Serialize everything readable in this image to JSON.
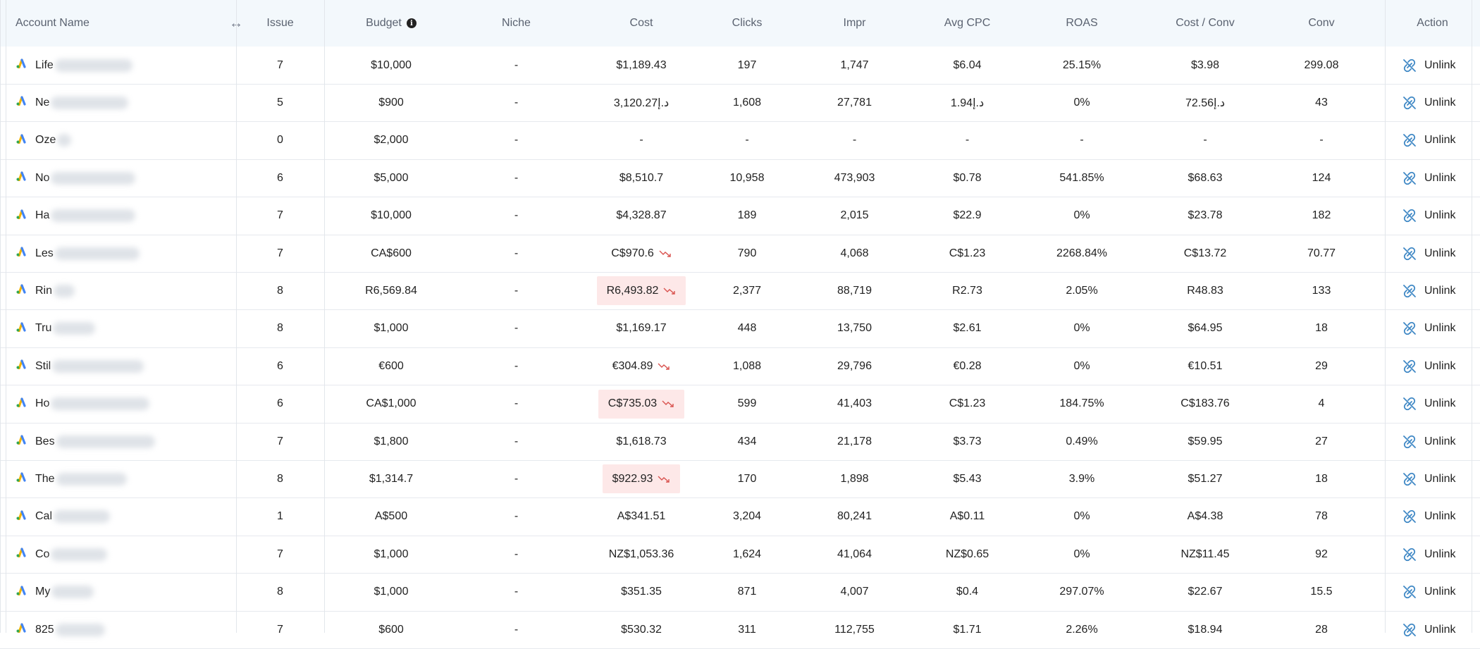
{
  "header": {
    "account_name": "Account Name",
    "issue": "Issue",
    "budget": "Budget",
    "niche": "Niche",
    "cost": "Cost",
    "clicks": "Clicks",
    "impr": "Impr",
    "avg_cpc": "Avg CPC",
    "roas": "ROAS",
    "cost_conv": "Cost / Conv",
    "conv": "Conv",
    "action": "Action"
  },
  "icons": {
    "column_resize": "left-right-arrow-icon",
    "budget_info": "info-icon",
    "account_platform": "google-ads-icon",
    "unlink": "unlink-icon",
    "trend_down": "trend-down-icon"
  },
  "colors": {
    "issue": "#cf6a66",
    "link": "#3f88c5",
    "cost_alert_bg": "#fde8e8",
    "header_bg": "#f3f8fc"
  },
  "rows": [
    {
      "name": "Life",
      "issue": "7",
      "budget": "$10,000",
      "niche": "-",
      "cost": "$1,189.43",
      "clicks": "197",
      "impr": "1,747",
      "avg_cpc": "$6.04",
      "roas": "25.15%",
      "cost_conv": "$3.98",
      "conv": "299.08",
      "action": "Unlink"
    },
    {
      "name": "Ne",
      "issue": "5",
      "budget": "$900",
      "niche": "-",
      "cost": "3,120.27د.إ",
      "clicks": "1,608",
      "impr": "27,781",
      "avg_cpc": "1.94د.إ",
      "roas": "0%",
      "cost_conv": "72.56د.إ",
      "conv": "43",
      "action": "Unlink"
    },
    {
      "name": "Oze",
      "issue": "0",
      "budget": "$2,000",
      "niche": "-",
      "cost": "-",
      "clicks": "-",
      "impr": "-",
      "avg_cpc": "-",
      "roas": "-",
      "cost_conv": "-",
      "conv": "-",
      "action": "Unlink"
    },
    {
      "name": "No",
      "issue": "6",
      "budget": "$5,000",
      "niche": "-",
      "cost": "$8,510.7",
      "clicks": "10,958",
      "impr": "473,903",
      "avg_cpc": "$0.78",
      "roas": "541.85%",
      "cost_conv": "$68.63",
      "conv": "124",
      "action": "Unlink"
    },
    {
      "name": "Ha",
      "issue": "7",
      "budget": "$10,000",
      "niche": "-",
      "cost": "$4,328.87",
      "clicks": "189",
      "impr": "2,015",
      "avg_cpc": "$22.9",
      "roas": "0%",
      "cost_conv": "$23.78",
      "conv": "182",
      "action": "Unlink"
    },
    {
      "name": "Les",
      "issue": "7",
      "budget": "CA$600",
      "niche": "-",
      "cost": "C$970.6",
      "cost_trend": true,
      "clicks": "790",
      "impr": "4,068",
      "avg_cpc": "C$1.23",
      "roas": "2268.84%",
      "cost_conv": "C$13.72",
      "conv": "70.77",
      "action": "Unlink"
    },
    {
      "name": "Rin",
      "issue": "8",
      "budget": "R6,569.84",
      "budget_link": true,
      "niche": "-",
      "cost": "R6,493.82",
      "cost_trend": true,
      "cost_alert": true,
      "clicks": "2,377",
      "impr": "88,719",
      "avg_cpc": "R2.73",
      "roas": "2.05%",
      "cost_conv": "R48.83",
      "conv": "133",
      "action": "Unlink"
    },
    {
      "name": "Tru",
      "issue": "8",
      "budget": "$1,000",
      "niche": "-",
      "cost": "$1,169.17",
      "clicks": "448",
      "impr": "13,750",
      "avg_cpc": "$2.61",
      "roas": "0%",
      "cost_conv": "$64.95",
      "conv": "18",
      "action": "Unlink"
    },
    {
      "name": "Stil",
      "issue": "6",
      "budget": "€600",
      "niche": "-",
      "cost": "€304.89",
      "cost_trend": true,
      "clicks": "1,088",
      "impr": "29,796",
      "avg_cpc": "€0.28",
      "roas": "0%",
      "cost_conv": "€10.51",
      "conv": "29",
      "action": "Unlink"
    },
    {
      "name": "Ho",
      "issue": "6",
      "budget": "CA$1,000",
      "niche": "-",
      "cost": "C$735.03",
      "cost_trend": true,
      "cost_alert": true,
      "clicks": "599",
      "impr": "41,403",
      "avg_cpc": "C$1.23",
      "roas": "184.75%",
      "cost_conv": "C$183.76",
      "conv": "4",
      "action": "Unlink"
    },
    {
      "name": "Bes",
      "issue": "7",
      "budget": "$1,800",
      "niche": "-",
      "cost": "$1,618.73",
      "clicks": "434",
      "impr": "21,178",
      "avg_cpc": "$3.73",
      "roas": "0.49%",
      "cost_conv": "$59.95",
      "conv": "27",
      "action": "Unlink"
    },
    {
      "name": "The",
      "issue": "8",
      "budget": "$1,314.7",
      "budget_link": true,
      "niche": "-",
      "cost": "$922.93",
      "cost_trend": true,
      "cost_alert": true,
      "clicks": "170",
      "impr": "1,898",
      "avg_cpc": "$5.43",
      "roas": "3.9%",
      "cost_conv": "$51.27",
      "conv": "18",
      "action": "Unlink"
    },
    {
      "name": "Cal",
      "issue": "1",
      "budget": "A$500",
      "niche": "-",
      "cost": "A$341.51",
      "clicks": "3,204",
      "impr": "80,241",
      "avg_cpc": "A$0.11",
      "roas": "0%",
      "cost_conv": "A$4.38",
      "conv": "78",
      "action": "Unlink"
    },
    {
      "name": "Co",
      "issue": "7",
      "budget": "$1,000",
      "niche": "-",
      "cost": "NZ$1,053.36",
      "clicks": "1,624",
      "impr": "41,064",
      "avg_cpc": "NZ$0.65",
      "roas": "0%",
      "cost_conv": "NZ$11.45",
      "conv": "92",
      "action": "Unlink"
    },
    {
      "name": "My",
      "issue": "8",
      "budget": "$1,000",
      "niche": "-",
      "cost": "$351.35",
      "clicks": "871",
      "impr": "4,007",
      "avg_cpc": "$0.4",
      "roas": "297.07%",
      "cost_conv": "$22.67",
      "conv": "15.5",
      "action": "Unlink"
    },
    {
      "name": "825",
      "issue": "7",
      "budget": "$600",
      "niche": "-",
      "cost": "$530.32",
      "clicks": "311",
      "impr": "112,755",
      "avg_cpc": "$1.71",
      "roas": "2.26%",
      "cost_conv": "$18.94",
      "conv": "28",
      "action": "Unlink"
    }
  ]
}
